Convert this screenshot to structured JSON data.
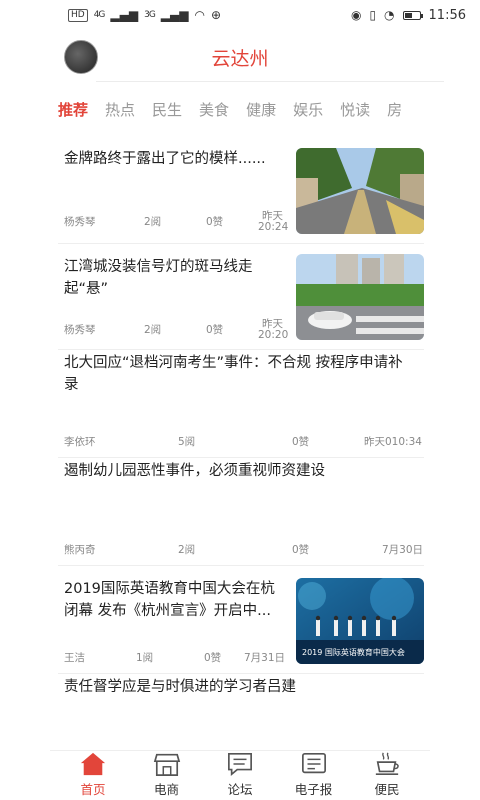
{
  "status_bar": {
    "hd": "HD",
    "signal_1": "4G",
    "signal_2": "3G",
    "time": "11:56"
  },
  "header": {
    "title": "云达州"
  },
  "tabs": [
    {
      "label": "推荐",
      "active": true
    },
    {
      "label": "热点"
    },
    {
      "label": "民生"
    },
    {
      "label": "美食"
    },
    {
      "label": "健康"
    },
    {
      "label": "娱乐"
    },
    {
      "label": "悦读"
    },
    {
      "label": "房"
    }
  ],
  "news": [
    {
      "title_line1": "金牌路终于露出了它的模样......",
      "title_line2": "",
      "author": "杨秀琴",
      "reads": "2阅",
      "likes": "0赞",
      "date_line1": "昨天",
      "date_line2": "20:24"
    },
    {
      "title_line1": "江湾城没装信号灯的斑马线走",
      "title_line2": "起“悬”",
      "author": "杨秀琴",
      "reads": "2阅",
      "likes": "0赞",
      "date_line1": "昨天",
      "date_line2": "20:20"
    },
    {
      "title_line1": "北大回应“退档河南考生”事件：不合规 按程序申请补",
      "title_line2": "录",
      "author": "李依环",
      "reads": "5阅",
      "likes": "0赞",
      "date": "昨天010:34"
    },
    {
      "title_line1": "遏制幼儿园恶性事件，必须重视师资建设",
      "title_line2": "",
      "author": "熊丙奇",
      "reads": "2阅",
      "likes": "0赞",
      "date": "7月30日"
    },
    {
      "title_line1": "2019国际英语教育中国大会在杭",
      "title_line2": "闭幕 发布《杭州宣言》开启中...",
      "author": "王洁",
      "reads": "1阅",
      "likes": "0赞",
      "date": "7月31日",
      "thumb_caption": "2019 国际英语教育中国大会"
    },
    {
      "title_line1": "责任督学应是与时俱进的学习者吕建",
      "title_line2": ""
    }
  ],
  "bottom_nav": [
    {
      "label": "首页",
      "icon": "home-icon",
      "active": true
    },
    {
      "label": "电商",
      "icon": "shop-icon"
    },
    {
      "label": "论坛",
      "icon": "forum-icon"
    },
    {
      "label": "电子报",
      "icon": "newspaper-icon"
    },
    {
      "label": "便民",
      "icon": "coffee-icon"
    }
  ],
  "colors": {
    "accent": "#e2453a",
    "muted": "#888888"
  }
}
